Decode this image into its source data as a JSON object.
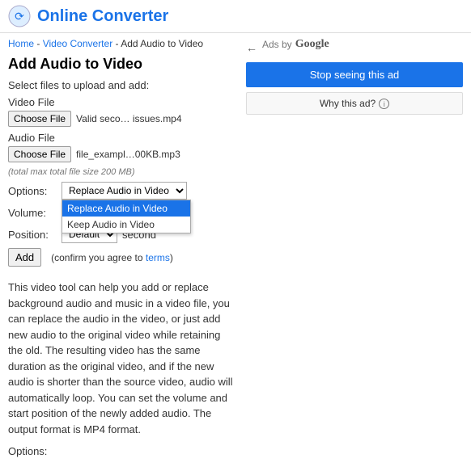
{
  "header": {
    "logo_alt": "Online Converter",
    "logo_label": "Online Converter"
  },
  "breadcrumb": {
    "home": "Home",
    "separator1": " - ",
    "video_converter": "Video Converter",
    "separator2": " - ",
    "current": "Add Audio to Video"
  },
  "main": {
    "page_title": "Add Audio to Video",
    "select_label": "Select files to upload and add:",
    "video_file_label": "Video File",
    "audio_file_label": "Audio File",
    "choose_file_label": "Choose File",
    "choose_file_label2": "Choose File",
    "video_filename": "Valid seco…  issues.mp4",
    "audio_filename": "file_exampl…00KB.mp3",
    "file_size_note": "(total max total file size 200 MB)",
    "options_label": "Options:",
    "volume_label": "Volume:",
    "position_label": "Position:",
    "dropdown_value": "Replace Audio in Video",
    "dropdown_items": [
      {
        "label": "Replace Audio in Video",
        "selected": true
      },
      {
        "label": "Keep Audio in Video",
        "selected": false
      }
    ],
    "position_options": [
      {
        "label": "Default",
        "selected": true
      }
    ],
    "second_label": "second",
    "add_button_label": "Add",
    "confirm_text": "(confirm you agree to",
    "terms_label": "terms",
    "confirm_close": ")"
  },
  "description": {
    "paragraph": "This video tool can help you add or replace background audio and music in a video file, you can replace the audio in the video, or just add new audio to the original video while retaining the old. The resulting video has the same duration as the original video, and if the new audio is shorter than the source video, audio will automatically loop. You can set the volume and start position of the newly added audio. The output format is MP4 format.",
    "options_header": "Options:"
  },
  "ad": {
    "ads_by": "Ads by",
    "google": "Google",
    "stop_seeing": "Stop seeing this ad",
    "why_this_ad": "Why this ad?"
  }
}
